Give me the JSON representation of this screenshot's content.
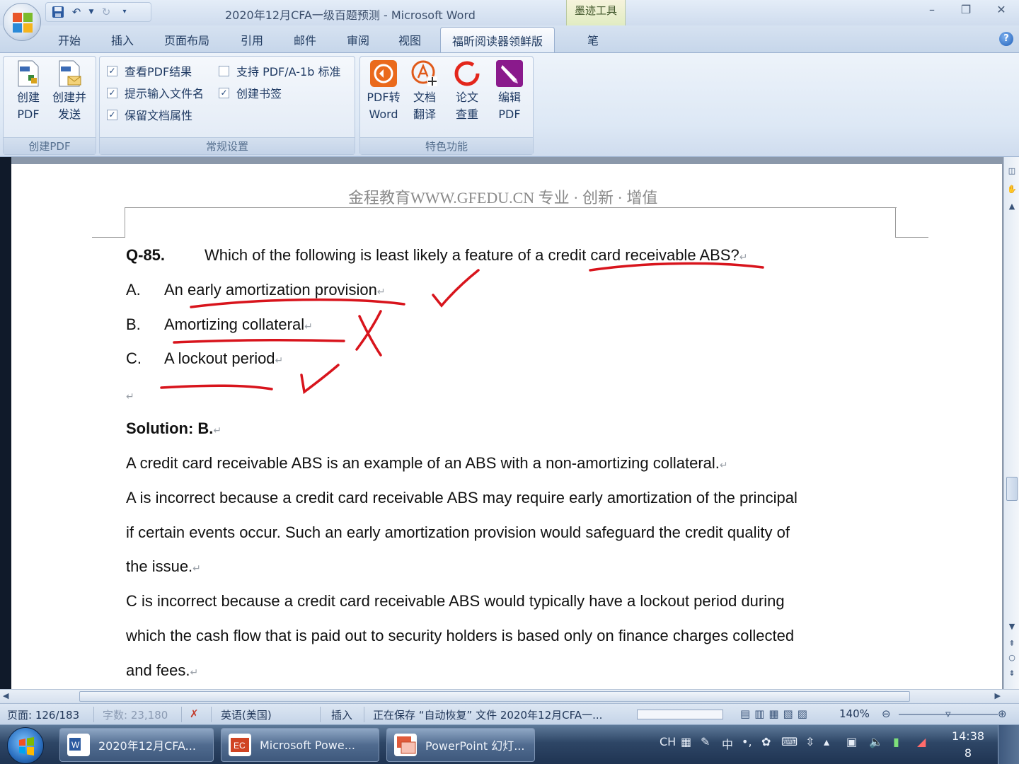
{
  "window": {
    "title": "2020年12月CFA一级百题预测 - Microsoft Word",
    "contextual_tab": "墨迹工具",
    "controls": [
      "–",
      "❐",
      "✕"
    ]
  },
  "tabs": [
    {
      "label": "开始"
    },
    {
      "label": "插入"
    },
    {
      "label": "页面布局"
    },
    {
      "label": "引用"
    },
    {
      "label": "邮件"
    },
    {
      "label": "审阅"
    },
    {
      "label": "视图"
    },
    {
      "label": "福昕阅读器领鲜版",
      "active": true
    },
    {
      "label": "笔"
    }
  ],
  "ribbon": {
    "create_pdf": {
      "label": "创建PDF",
      "buttons": [
        {
          "line1": "创建",
          "line2": "PDF"
        },
        {
          "line1": "创建并",
          "line2": "发送"
        }
      ]
    },
    "settings": {
      "label": "常规设置",
      "checkboxes": [
        {
          "label": "查看PDF结果",
          "checked": true
        },
        {
          "label": "提示输入文件名",
          "checked": true
        },
        {
          "label": "保留文档属性",
          "checked": true
        },
        {
          "label": "支持 PDF/A-1b 标准",
          "checked": false
        },
        {
          "label": "创建书签",
          "checked": true
        }
      ]
    },
    "features": {
      "label": "特色功能",
      "buttons": [
        {
          "line1": "PDF转",
          "line2": "Word"
        },
        {
          "line1": "文档",
          "line2": "翻译"
        },
        {
          "line1": "论文",
          "line2": "查重"
        },
        {
          "line1": "编辑",
          "line2": "PDF"
        }
      ]
    }
  },
  "document": {
    "header": "金程教育WWW.GFEDU.CN 专业 · 创新 · 增值",
    "question": {
      "number": "Q-85.",
      "text": "Which of the following is least likely a feature of a credit card receivable ABS?",
      "options": [
        {
          "letter": "A.",
          "text": "An early amortization provision"
        },
        {
          "letter": "B.",
          "text": "Amortizing collateral"
        },
        {
          "letter": "C.",
          "text": "A lockout period"
        }
      ]
    },
    "solution_title": "Solution: B.",
    "lines": [
      "A credit card receivable ABS is an example of an ABS with a non-amortizing collateral.",
      "A is incorrect because a credit card receivable ABS may require early amortization of the principal",
      "if certain events occur. Such an early amortization provision would safeguard the credit quality of",
      "the issue.",
      "C is incorrect because a credit card receivable ABS would typically have a lockout period during",
      "which the cash flow that is paid out to security holders is based only on finance charges collected",
      "and fees."
    ],
    "para_mark": "↵",
    "ink_color": "#d8141c"
  },
  "status": {
    "page": "页面: 126/183",
    "words": "字数: 23,180",
    "language": "英语(美国)",
    "mode": "插入",
    "saving": "正在保存 “自动恢复” 文件 2020年12月CFA一...",
    "zoom": "140%"
  },
  "taskbar": {
    "tasks": [
      {
        "label": "2020年12月CFA..."
      },
      {
        "label": "Microsoft Powe..."
      },
      {
        "label": "PowerPoint 幻灯..."
      }
    ],
    "tray_lang": "CH",
    "ime": "中",
    "time": "14:38",
    "date_line": "8"
  }
}
